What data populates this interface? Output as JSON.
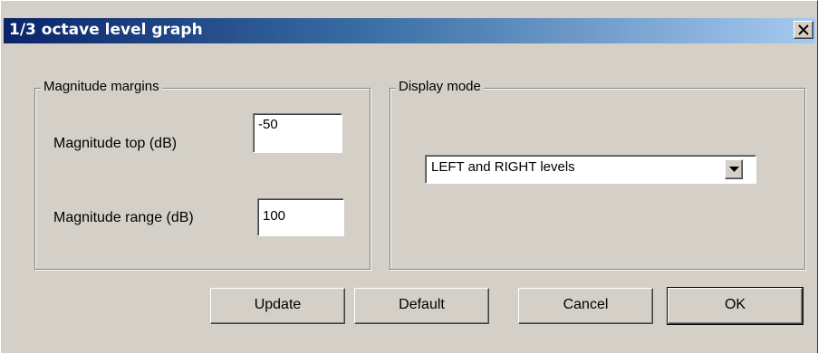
{
  "window": {
    "title": "1/3 octave level graph",
    "close_icon": "close-icon"
  },
  "magnitude_margins": {
    "legend": "Magnitude margins",
    "top_label": "Magnitude top (dB)",
    "top_value": "-50",
    "range_label": "Magnitude range (dB)",
    "range_value": "100"
  },
  "display_mode": {
    "legend": "Display mode",
    "selected": "LEFT and RIGHT levels",
    "dropdown_icon": "chevron-down-icon"
  },
  "buttons": {
    "update": "Update",
    "default": "Default",
    "cancel": "Cancel",
    "ok": "OK"
  },
  "colors": {
    "titlebar_start": "#0a246a",
    "titlebar_end": "#a6caf0",
    "face": "#d4d0c8"
  }
}
